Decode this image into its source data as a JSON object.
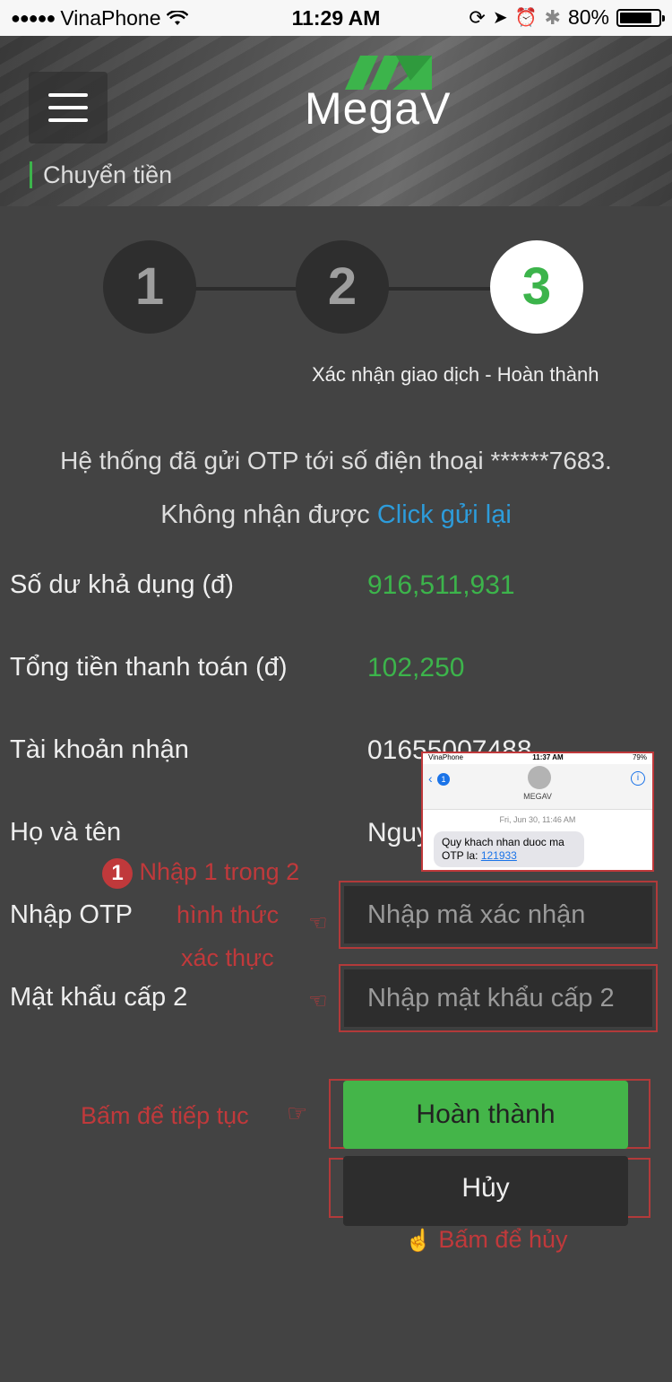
{
  "status_bar": {
    "carrier": "VinaPhone",
    "time": "11:29 AM",
    "battery": "80%"
  },
  "header": {
    "brand": "MegaV",
    "breadcrumb": "Chuyển tiền"
  },
  "stepper": {
    "steps": [
      "1",
      "2",
      "3"
    ],
    "active_step": 3,
    "active_label": "Xác nhận giao dịch - Hoàn thành"
  },
  "otp_notice": {
    "message": "Hệ thống đã gửi OTP tới số điện thoại ******7683.",
    "not_received": "Không nhận được",
    "resend_link": "Click gửi lại"
  },
  "details": {
    "balance_label": "Số dư khả dụng (đ)",
    "balance_value": "916,511,931",
    "total_label": "Tổng tiền thanh toán (đ)",
    "total_value": "102,250",
    "account_label": "Tài khoản nhận",
    "account_value": "01655007488",
    "name_label": "Họ và tên",
    "name_value": "Nguy"
  },
  "form": {
    "otp_label": "Nhập OTP",
    "otp_placeholder": "Nhập mã xác nhận",
    "pin_label": "Mật khẩu cấp 2",
    "pin_placeholder": "Nhập mật khẩu cấp 2",
    "submit_label": "Hoàn thành",
    "cancel_label": "Hủy"
  },
  "annotations": {
    "badge": "1",
    "choose_line1": "Nhập 1 trong 2",
    "choose_line2": "hình thức",
    "choose_line3": "xác thực",
    "continue_hint": "Bấm để tiếp tục",
    "cancel_hint": "Bấm để hủy"
  },
  "sms_inset": {
    "carrier": "VinaPhone",
    "time": "11:37 AM",
    "battery": "79%",
    "unread_count": "1",
    "sender": "MEGAV",
    "date": "Fri, Jun 30, 11:46 AM",
    "message_text": "Quy khach nhan duoc ma OTP la:",
    "otp_code": "121933"
  },
  "colors": {
    "accent_green": "#3cb44b",
    "link_blue": "#2d9cdb",
    "annotation_red": "#c0393b",
    "background": "#434343"
  }
}
